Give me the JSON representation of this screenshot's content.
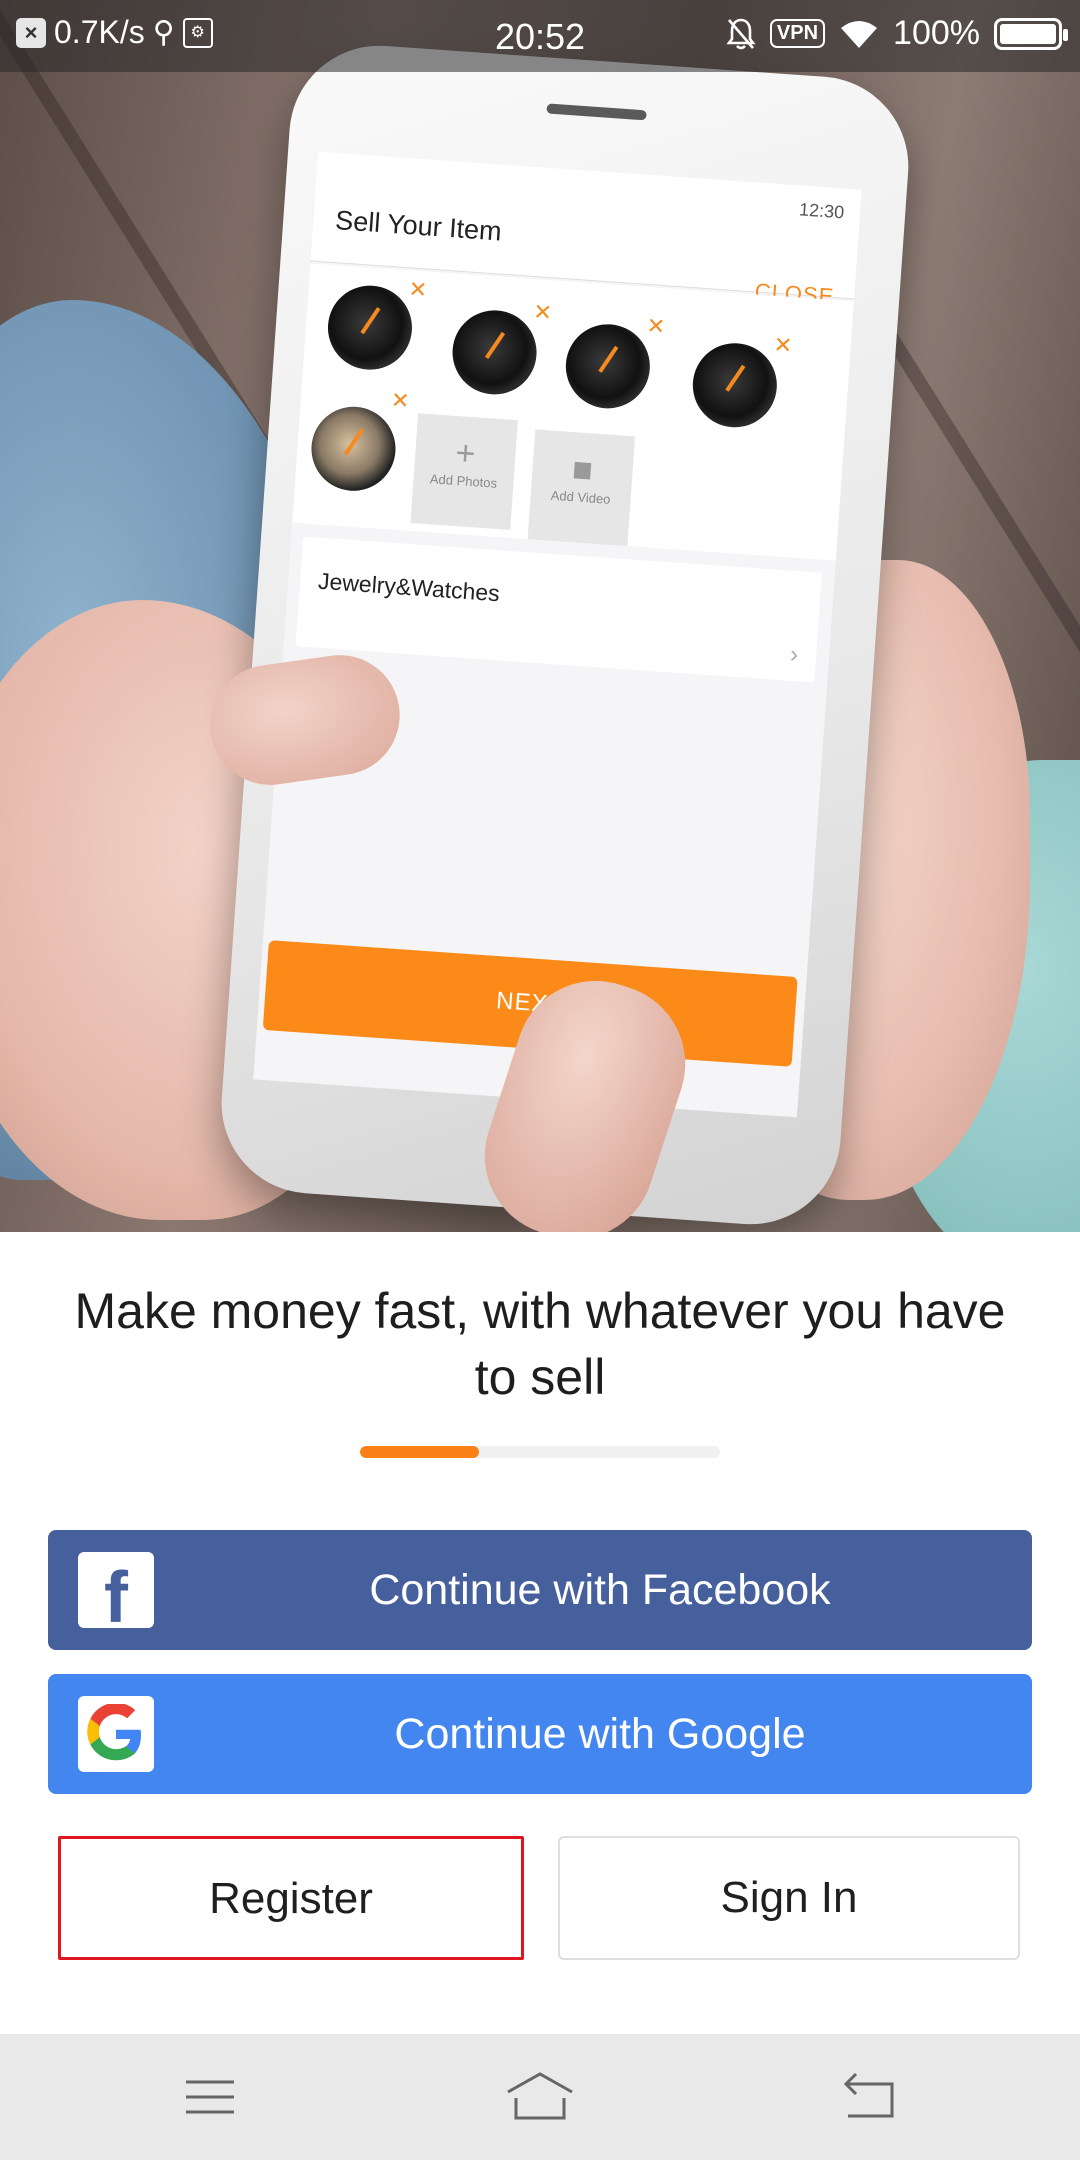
{
  "status_bar": {
    "net_speed": "0.7K/s",
    "time": "20:52",
    "vpn": "VPN",
    "battery": "100%",
    "icons": [
      "close-notification-icon",
      "usb-icon",
      "debug-icon",
      "mute-bell-icon",
      "vpn-icon",
      "wifi-icon",
      "battery-icon"
    ]
  },
  "hero_phone": {
    "title": "Sell Your Item",
    "close": "CLOSE",
    "time": "12:30",
    "add_photos": "Add Photos",
    "add_video": "Add Video",
    "category": "Jewelry&Watches",
    "next": "NEXT"
  },
  "headline": "Make money fast, with whatever you have to sell",
  "onboarding_progress": 0.33,
  "buttons": {
    "facebook": "Continue with Facebook",
    "google": "Continue with Google",
    "register": "Register",
    "sign_in": "Sign In"
  },
  "colors": {
    "accent": "#fb7f17",
    "facebook": "#465f9d",
    "google": "#4486f0",
    "highlight": "#e0161e"
  },
  "nav_bar": {
    "icons": [
      "menu-icon",
      "home-icon",
      "back-icon"
    ]
  }
}
